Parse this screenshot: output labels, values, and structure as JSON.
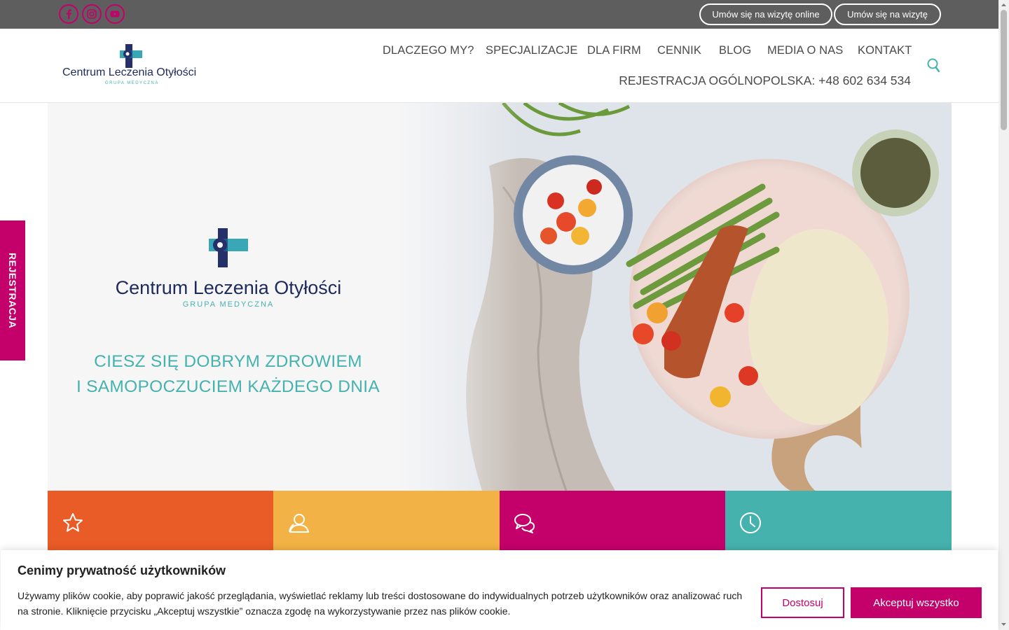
{
  "topbar": {
    "social": [
      {
        "name": "facebook-icon",
        "glyph": "f"
      },
      {
        "name": "instagram-icon"
      },
      {
        "name": "youtube-icon"
      }
    ],
    "btn_online": "Umów się na wizytę online",
    "btn_visit": "Umów się na wizytę"
  },
  "brand": {
    "name": "Centrum Leczenia Otyłości",
    "sub": "GRUPA MEDYCZNA"
  },
  "nav": {
    "items": [
      "DLACZEGO MY?",
      "SPECJALIZACJE",
      "DLA FIRM",
      "CENNIK",
      "BLOG",
      "MEDIA O NAS",
      "KONTAKT"
    ],
    "phone": "REJESTRACJA OGÓLNOPOLSKA: +48 602 634 534"
  },
  "side_tab": {
    "label": "REJESTRACJA"
  },
  "hero": {
    "tagline_line1": "CIESZ SIĘ DOBRYM ZDROWIEM",
    "tagline_line2": "I SAMOPOCZUCIEM KAŻDEGO DNIA"
  },
  "tiles": [
    {
      "icon": "star-icon",
      "color": "#e95b27"
    },
    {
      "icon": "user-icon",
      "color": "#f3b245"
    },
    {
      "icon": "chat-icon",
      "color": "#c4006b"
    },
    {
      "icon": "clock-icon",
      "color": "#45b2ae"
    }
  ],
  "cookie": {
    "title": "Cenimy prywatność użytkowników",
    "text": "Używamy plików cookie, aby poprawić jakość przeglądania, wyświetlać reklamy lub treści dostosowane do indywidualnych potrzeb użytkowników oraz analizować ruch na stronie. Kliknięcie przycisku „Akceptuj wszystkie” oznacza zgodę na wykorzystywanie przez nas plików cookie.",
    "btn_customize": "Dostosuj",
    "btn_accept": "Akceptuj wszystko"
  },
  "colors": {
    "accent": "#c4006b",
    "teal": "#45b2ae",
    "navy": "#1e2a5e",
    "orange": "#e95b27",
    "yellow": "#f3b245",
    "topbar": "#5e5e5e"
  }
}
